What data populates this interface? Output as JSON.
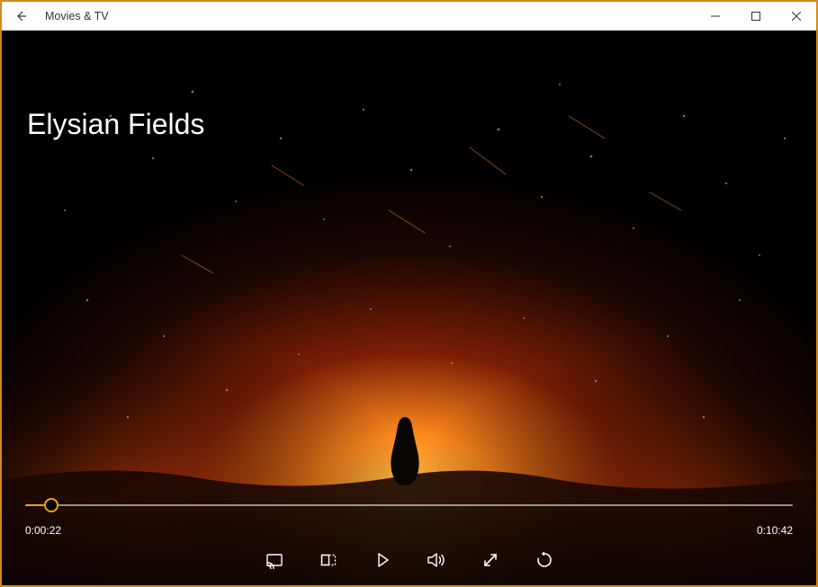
{
  "app": {
    "title": "Movies & TV"
  },
  "video": {
    "title": "Elysian Fields",
    "elapsed": "0:00:22",
    "duration": "0:10:42",
    "progress_pct": 3.4
  },
  "icons": {
    "back": "back-arrow",
    "minimize": "minimize",
    "maximize": "maximize",
    "close": "close",
    "cast": "cast-to-device",
    "aspect": "aspect-ratio",
    "play": "play",
    "volume": "volume",
    "fullscreen": "fullscreen",
    "repeat": "repeat"
  },
  "colors": {
    "accent": "#f2a500"
  }
}
